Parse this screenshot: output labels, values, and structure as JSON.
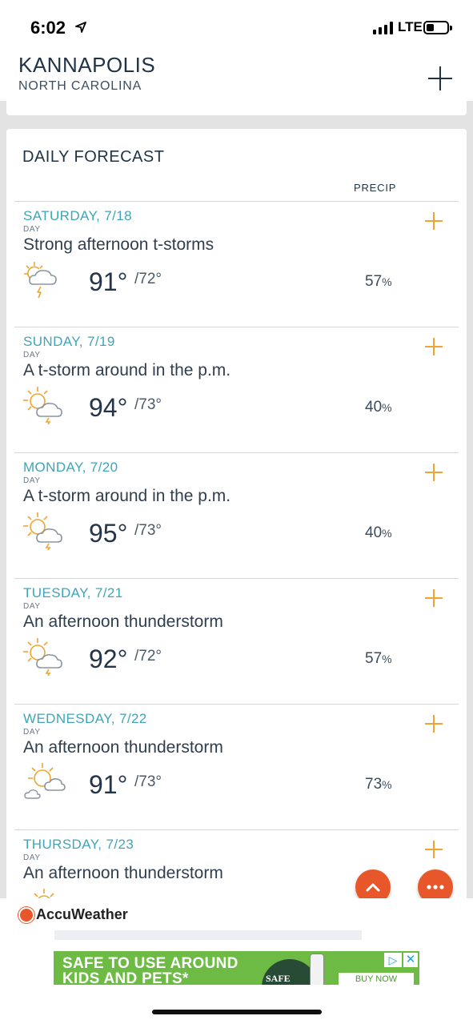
{
  "status_bar": {
    "time": "6:02",
    "network": "LTE",
    "icons": [
      "location-arrow-icon",
      "signal-icon",
      "battery-icon"
    ]
  },
  "header": {
    "city": "KANNAPOLIS",
    "region": "NORTH CAROLINA",
    "add_icon": "plus-icon"
  },
  "forecast": {
    "title": "DAILY FORECAST",
    "precip_header": "PRECIP",
    "days": [
      {
        "date": "SATURDAY, 7/18",
        "period": "DAY",
        "phrase": "Strong afternoon t-storms",
        "high": "91°",
        "low": "/72°",
        "precip": "57",
        "precip_unit": "%",
        "icon": "thunderstorm-icon"
      },
      {
        "date": "SUNDAY, 7/19",
        "period": "DAY",
        "phrase": "A t-storm around in the p.m.",
        "high": "94°",
        "low": "/73°",
        "precip": "40",
        "precip_unit": "%",
        "icon": "sun-thunderstorm-icon"
      },
      {
        "date": "MONDAY, 7/20",
        "period": "DAY",
        "phrase": "A t-storm around in the p.m.",
        "high": "95°",
        "low": "/73°",
        "precip": "40",
        "precip_unit": "%",
        "icon": "sun-thunderstorm-icon"
      },
      {
        "date": "TUESDAY, 7/21",
        "period": "DAY",
        "phrase": "An afternoon thunderstorm",
        "high": "92°",
        "low": "/72°",
        "precip": "57",
        "precip_unit": "%",
        "icon": "sun-thunderstorm-icon"
      },
      {
        "date": "WEDNESDAY, 7/22",
        "period": "DAY",
        "phrase": "An afternoon thunderstorm",
        "high": "91°",
        "low": "/73°",
        "precip": "73",
        "precip_unit": "%",
        "icon": "sun-cloud-icon"
      },
      {
        "date": "THURSDAY, 7/23",
        "period": "DAY",
        "phrase": "An afternoon thunderstorm",
        "high": "",
        "low": "",
        "precip": "",
        "precip_unit": "",
        "icon": "sun-icon"
      }
    ]
  },
  "brand": {
    "name": "AccuWeather"
  },
  "ad": {
    "headline": "SAFE TO USE AROUND KIDS AND PETS*",
    "logo_text": "SAFE",
    "cta": "BUY NOW",
    "choices_icon": "▷",
    "close_icon": "✕"
  },
  "colors": {
    "accent_orange": "#f0a431",
    "fab": "#e8572a",
    "date_teal": "#3fa5b8",
    "ad_green": "#6dbb45"
  }
}
